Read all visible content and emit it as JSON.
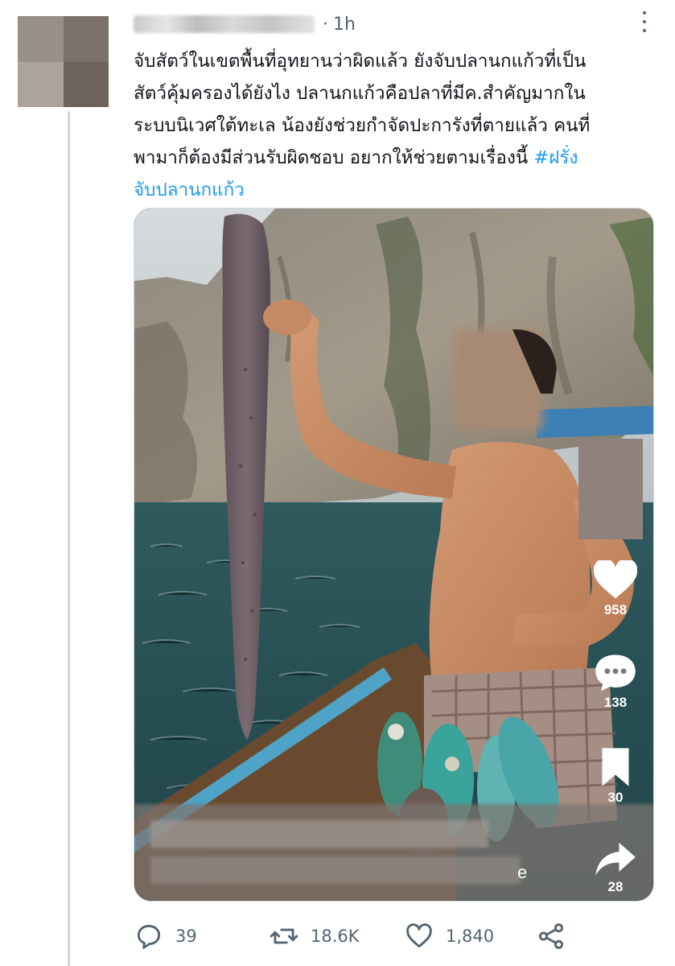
{
  "tweet": {
    "separator": "·",
    "time": "1h",
    "text_lines": [
      "จับสัตว์ในเขตพื้นที่อุทยานว่าผิดแล้ว ยังจับปลานกแก้วที่เป็น",
      "สัตว์คุ้มครองได้ยังไง ปลานกแก้วคือปลาที่มีค.สำคัญมากใน",
      "ระบบนิเวศใต้ทะเล น้องยังช่วยกำจัดปะการังที่ตายแล้ว คนที่",
      "พามาก็ต้องมีส่วนรับผิดชอบ อยากให้ช่วยตามเรื่องนี้ "
    ],
    "hashtag_part1": "#ฝรั่ง",
    "hashtag_part2": "จับปลานกแก้ว"
  },
  "video_overlay": {
    "like_count": "958",
    "comment_count": "138",
    "save_count": "30",
    "share_count": "28",
    "caption_fragment": "e"
  },
  "actions": {
    "replies": "39",
    "retweets": "18.6K",
    "likes": "1,840"
  },
  "colors": {
    "accent": "#1d9bf0",
    "secondary_text": "#536471",
    "thread_line": "#cfd9de"
  }
}
